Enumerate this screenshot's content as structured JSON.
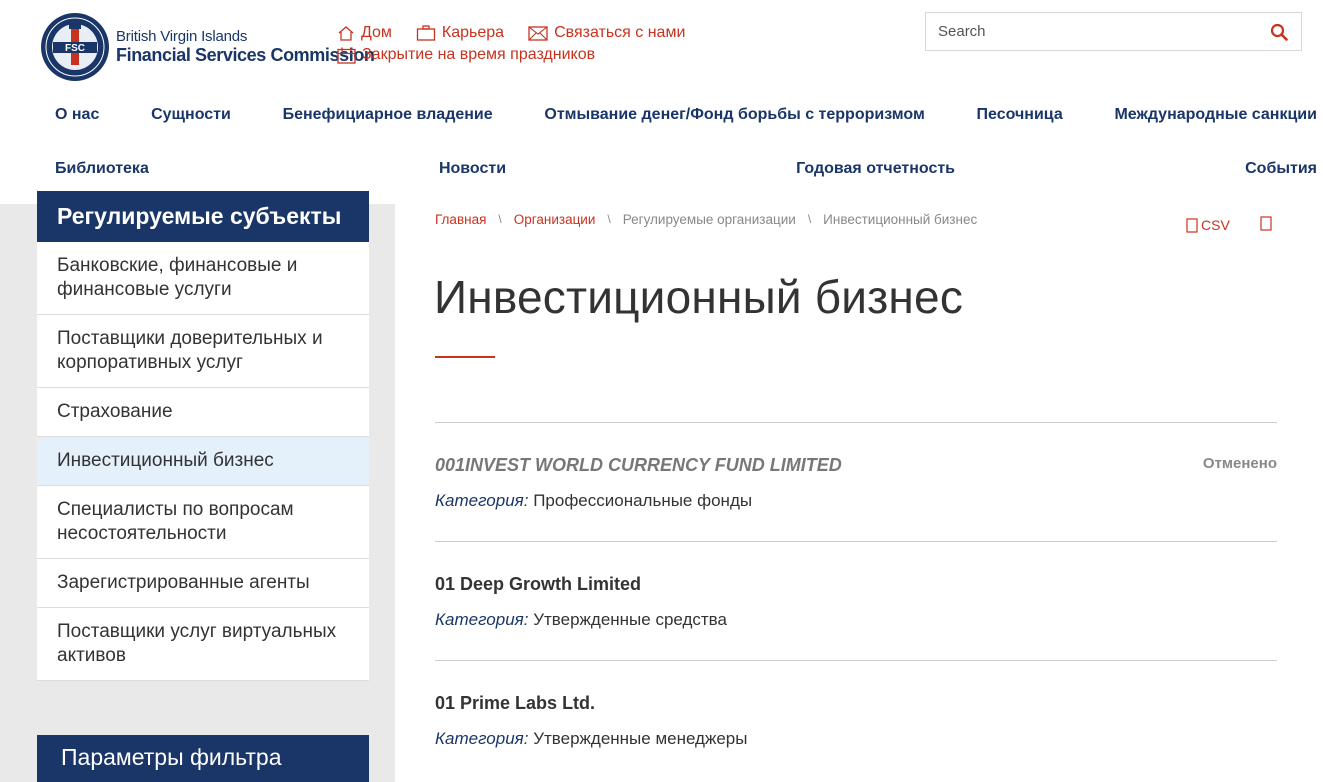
{
  "logo": {
    "line1": "British Virgin Islands",
    "line2": "Financial Services Commission",
    "seal_text": "FSC"
  },
  "utility": {
    "home": "Дом",
    "careers": "Карьера",
    "contact": "Связаться с нами",
    "holidays": "Закрытие на время праздников"
  },
  "search": {
    "placeholder": "Search"
  },
  "nav": {
    "row1": [
      "О нас",
      "Сущности",
      "Бенефициарное владение",
      "Отмывание денег/Фонд борьбы с терроризмом",
      "Песочница",
      "Международные санкции"
    ],
    "row2": [
      "Библиотека",
      "Новости",
      "Годовая отчетность",
      "События"
    ]
  },
  "sidebar": {
    "title": "Регулируемые субъекты",
    "items": [
      "Банковские, финансовые и финансовые услуги",
      "Поставщики доверительных и корпоративных услуг",
      "Страхование",
      "Инвестиционный бизнес",
      "Специалисты по вопросам несостоятельности",
      "Зарегистрированные агенты",
      "Поставщики услуг виртуальных активов"
    ],
    "active_index": 3,
    "filter_title": "Параметры фильтра"
  },
  "breadcrumb": [
    "Главная",
    "Организации",
    "Регулируемые организации",
    "Инвестиционный бизнес"
  ],
  "tools": {
    "csv": "CSV"
  },
  "page_title": "Инвестиционный бизнес",
  "category_label": "Категория:",
  "entries": [
    {
      "name": "001INVEST WORLD CURRENCY FUND LIMITED",
      "status": "Отменено",
      "category": "Профессиональные фонды"
    },
    {
      "name": "01 Deep Growth Limited",
      "status": "",
      "category": "Утвержденные средства"
    },
    {
      "name": "01 Prime Labs Ltd.",
      "status": "",
      "category": "Утвержденные менеджеры"
    }
  ],
  "colors": {
    "navy": "#1a3668",
    "accent": "#c8321e",
    "active_bg": "#e4f0fa"
  }
}
